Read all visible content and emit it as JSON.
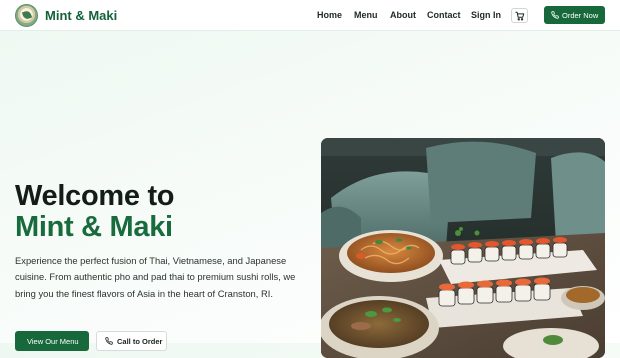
{
  "brand": {
    "name": "Mint & Maki",
    "logo_icon": "restaurant-logo-icon"
  },
  "nav": {
    "links": [
      {
        "label": "Home"
      },
      {
        "label": "Menu"
      },
      {
        "label": "About"
      },
      {
        "label": "Contact"
      },
      {
        "label": "Sign In"
      }
    ],
    "cart_icon": "shopping-cart-icon",
    "order_button": {
      "label": "Order Now",
      "icon": "phone-icon"
    }
  },
  "hero": {
    "title_line1": "Welcome to",
    "title_line2": "Mint & Maki",
    "description": "Experience the perfect fusion of Thai, Vietnamese, and Japanese cuisine. From authentic pho and pad thai to premium sushi rolls, we bring you the finest flavors of Asia in the heart of Cranston, RI.",
    "primary_button": "View Our Menu",
    "secondary_button": {
      "label": "Call to Order",
      "icon": "phone-icon"
    },
    "image": "food-spread-photo"
  },
  "colors": {
    "brand_green": "#17693b",
    "title_dark": "#141c17",
    "hero_bg": "#eef8f1"
  }
}
